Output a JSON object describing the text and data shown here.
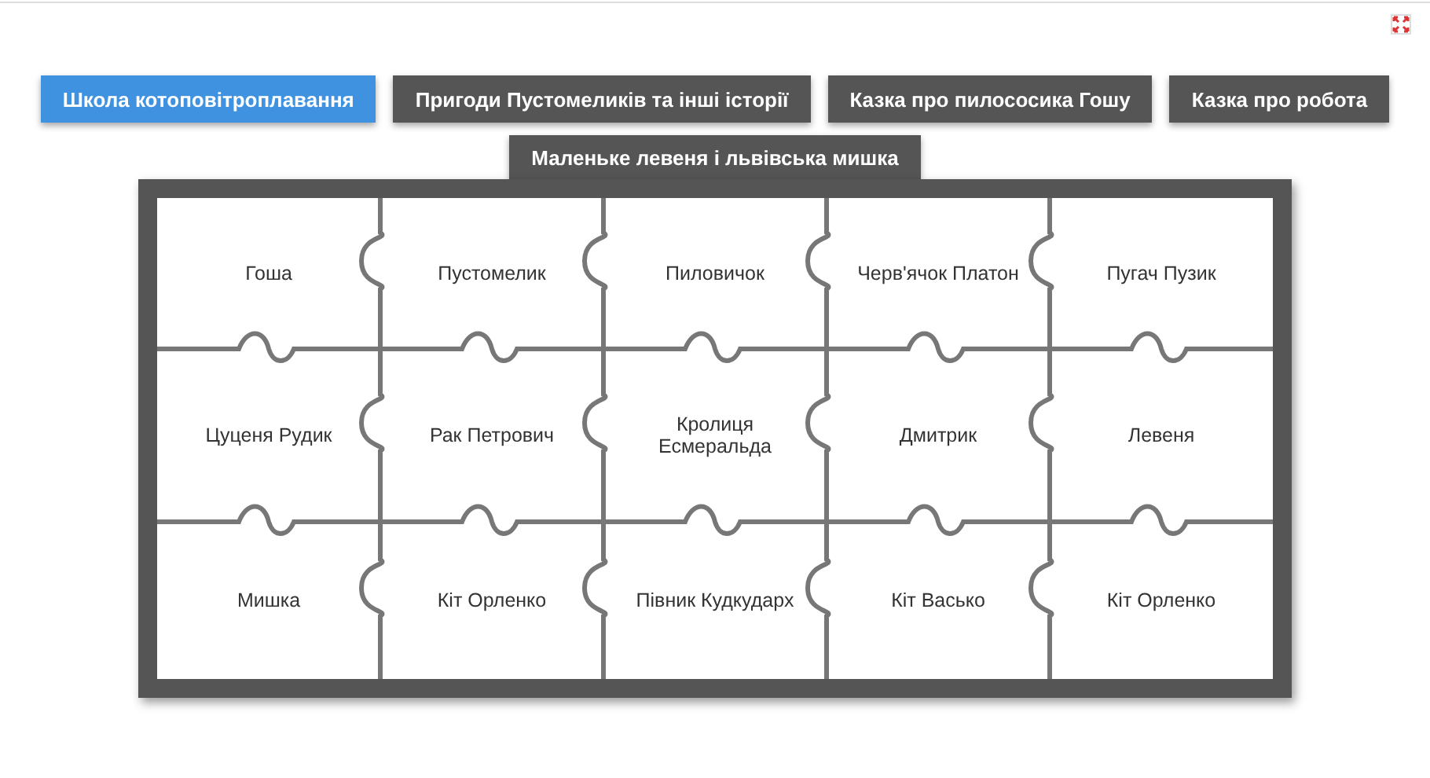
{
  "tabs": [
    {
      "label": "Школа котоповітроплавання",
      "selected": true
    },
    {
      "label": "Пригоди Пустомеликів та інші історії",
      "selected": false
    },
    {
      "label": "Казка про пилососика Гошу",
      "selected": false
    },
    {
      "label": "Казка про робота",
      "selected": false
    },
    {
      "label": "Маленьке левеня і львівська мишка",
      "selected": false
    }
  ],
  "puzzle": {
    "rows": [
      [
        "Гоша",
        "Пустомелик",
        "Пиловичок",
        "Черв'ячок Платон",
        "Пугач Пузик"
      ],
      [
        "Цуценя Рудик",
        "Рак Петрович",
        "Кролиця Есмеральда",
        "Дмитрик",
        "Левеня"
      ],
      [
        "Мишка",
        "Кіт Орленко",
        "Півник Кудкударх",
        "Кіт Васько",
        "Кіт Орленко"
      ]
    ]
  }
}
